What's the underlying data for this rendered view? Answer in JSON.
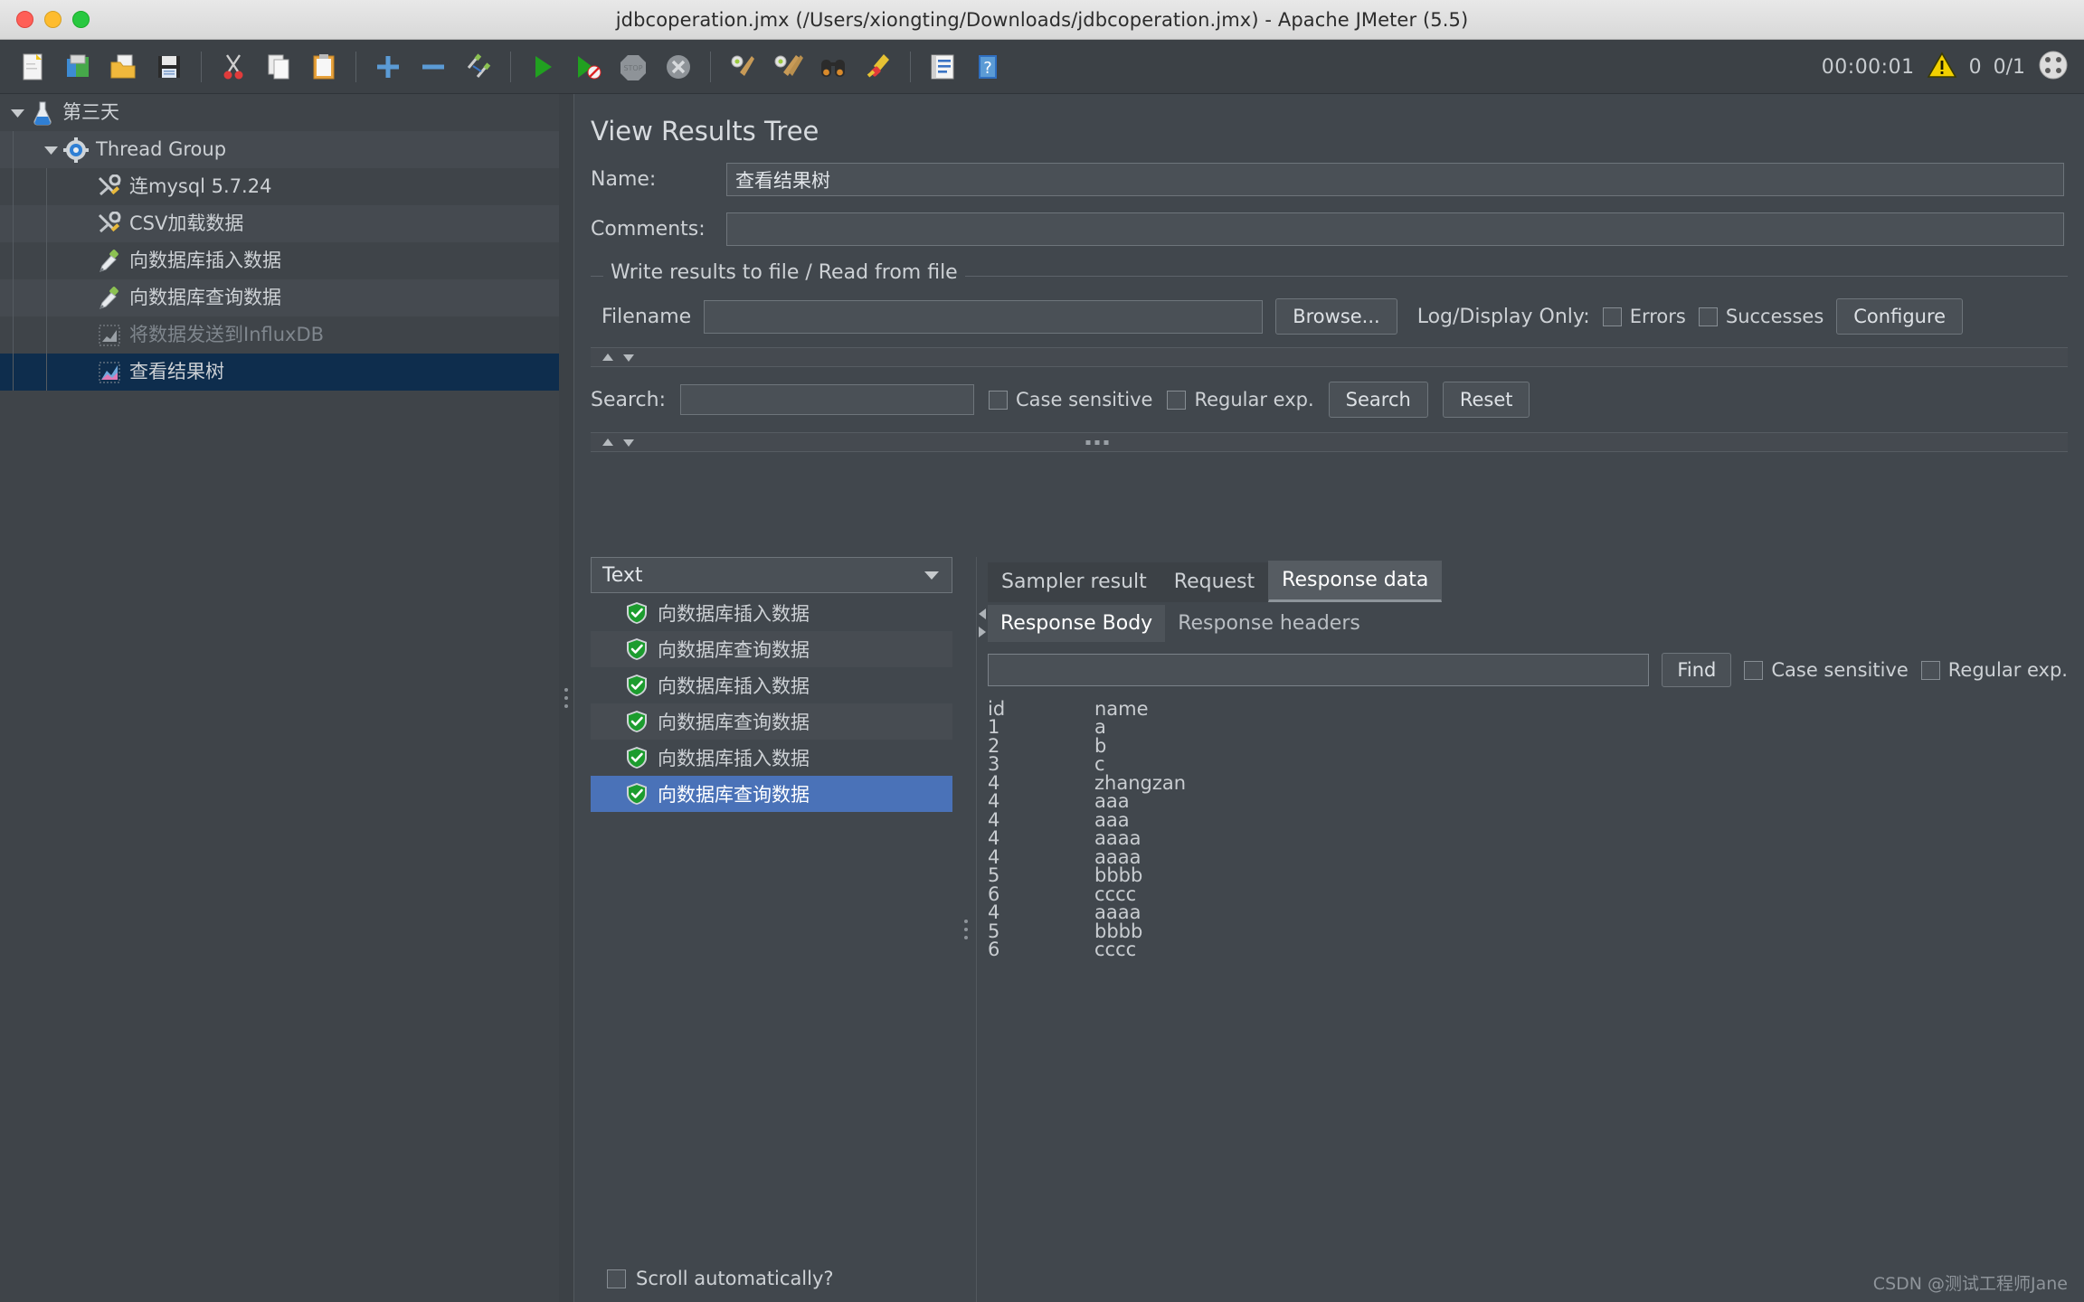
{
  "window": {
    "title": "jdbcoperation.jmx (/Users/xiongting/Downloads/jdbcoperation.jmx) - Apache JMeter (5.5)"
  },
  "toolbar": {
    "icons": [
      {
        "name": "new-icon",
        "glyph": "new"
      },
      {
        "name": "templates-icon",
        "glyph": "templates"
      },
      {
        "name": "open-icon",
        "glyph": "open"
      },
      {
        "name": "save-icon",
        "glyph": "save"
      },
      {
        "name": "cut-icon",
        "glyph": "cut"
      },
      {
        "name": "copy-icon",
        "glyph": "copy"
      },
      {
        "name": "paste-icon",
        "glyph": "paste"
      },
      {
        "name": "expand-icon",
        "glyph": "plus"
      },
      {
        "name": "collapse-icon",
        "glyph": "minus"
      },
      {
        "name": "toggle-icon",
        "glyph": "toggle"
      },
      {
        "name": "start-icon",
        "glyph": "play"
      },
      {
        "name": "start-no-pauses-icon",
        "glyph": "play-no"
      },
      {
        "name": "stop-icon",
        "glyph": "stop"
      },
      {
        "name": "shutdown-icon",
        "glyph": "shutdown"
      },
      {
        "name": "clear-icon",
        "glyph": "broom"
      },
      {
        "name": "clear-all-icon",
        "glyph": "broom2"
      },
      {
        "name": "search-icon",
        "glyph": "binoculars"
      },
      {
        "name": "search-reset-icon",
        "glyph": "brush"
      },
      {
        "name": "function-helper-icon",
        "glyph": "functions"
      },
      {
        "name": "help-icon",
        "glyph": "help"
      }
    ],
    "timer": "00:00:01",
    "warning_count": "0",
    "thread_count": "0/1"
  },
  "tree": {
    "items": [
      {
        "label": "第三天",
        "icon": "flask-icon",
        "depth": 0,
        "twisty": "down",
        "state": "normal"
      },
      {
        "label": "Thread Group",
        "icon": "gear-icon",
        "depth": 1,
        "twisty": "down",
        "state": "normal"
      },
      {
        "label": "连mysql 5.7.24",
        "icon": "config-tools-icon",
        "depth": 2,
        "twisty": "none",
        "state": "normal"
      },
      {
        "label": "CSV加载数据",
        "icon": "config-tools-icon",
        "depth": 2,
        "twisty": "none",
        "state": "normal"
      },
      {
        "label": "向数据库插入数据",
        "icon": "sampler-pipette-icon",
        "depth": 2,
        "twisty": "none",
        "state": "normal"
      },
      {
        "label": "向数据库查询数据",
        "icon": "sampler-pipette-icon",
        "depth": 2,
        "twisty": "none",
        "state": "normal"
      },
      {
        "label": "将数据发送到InfluxDB",
        "icon": "listener-chart-icon",
        "depth": 2,
        "twisty": "none",
        "state": "disabled"
      },
      {
        "label": "查看结果树",
        "icon": "listener-results-icon",
        "depth": 2,
        "twisty": "none",
        "state": "selected"
      }
    ]
  },
  "main": {
    "title": "View Results Tree",
    "name_label": "Name:",
    "name_value": "查看结果树",
    "comments_label": "Comments:",
    "comments_value": "",
    "file_group_legend": "Write results to file / Read from file",
    "filename_label": "Filename",
    "filename_value": "",
    "browse_button": "Browse...",
    "log_display_label": "Log/Display Only:",
    "errors_label": "Errors",
    "successes_label": "Successes",
    "configure_button": "Configure",
    "search_label": "Search:",
    "search_value": "",
    "case_sensitive_label": "Case sensitive",
    "regular_exp_label": "Regular exp.",
    "search_button": "Search",
    "reset_button": "Reset"
  },
  "results": {
    "renderer": "Text",
    "items": [
      {
        "label": "向数据库插入数据",
        "status": "success",
        "selected": false
      },
      {
        "label": "向数据库查询数据",
        "status": "success",
        "selected": false
      },
      {
        "label": "向数据库插入数据",
        "status": "success",
        "selected": false
      },
      {
        "label": "向数据库查询数据",
        "status": "success",
        "selected": false
      },
      {
        "label": "向数据库插入数据",
        "status": "success",
        "selected": false
      },
      {
        "label": "向数据库查询数据",
        "status": "success",
        "selected": true
      }
    ],
    "scroll_automatically_label": "Scroll automatically?"
  },
  "detail": {
    "tabs": [
      {
        "label": "Sampler result",
        "active": false
      },
      {
        "label": "Request",
        "active": false
      },
      {
        "label": "Response data",
        "active": true
      }
    ],
    "subtabs": [
      {
        "label": "Response Body",
        "active": true
      },
      {
        "label": "Response headers",
        "active": false
      }
    ],
    "find_value": "",
    "find_button": "Find",
    "case_sensitive_label": "Case sensitive",
    "regular_exp_label": "Regular exp.",
    "response_rows": [
      {
        "id": "id",
        "name": "name"
      },
      {
        "id": "1",
        "name": "a"
      },
      {
        "id": "2",
        "name": "b"
      },
      {
        "id": "3",
        "name": "c"
      },
      {
        "id": "4",
        "name": "zhangzan"
      },
      {
        "id": "4",
        "name": "aaa"
      },
      {
        "id": "4",
        "name": "aaa"
      },
      {
        "id": "4",
        "name": "aaaa"
      },
      {
        "id": "4",
        "name": "aaaa"
      },
      {
        "id": "5",
        "name": "bbbb"
      },
      {
        "id": "6",
        "name": "cccc"
      },
      {
        "id": "4",
        "name": "aaaa"
      },
      {
        "id": "5",
        "name": "bbbb"
      },
      {
        "id": "6",
        "name": "cccc"
      }
    ]
  },
  "watermark": "CSDN @测试工程师Jane",
  "colors": {
    "background": "#41474d",
    "panel": "#3f4449",
    "selection_tree": "#0e2d4d",
    "selection_list": "#4a72b8",
    "text": "#cdd1d5",
    "accent_green": "#26a33a",
    "warning_yellow": "#f2d000"
  }
}
